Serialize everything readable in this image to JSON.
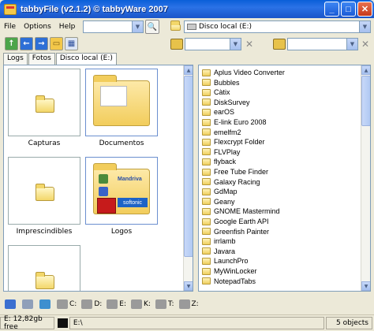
{
  "window": {
    "title": "tabbyFile (v2.1.2) © tabbyWare 2007",
    "min": "_",
    "max": "□",
    "close": "✕"
  },
  "menu": {
    "items": [
      "File",
      "Options",
      "Help"
    ]
  },
  "search": {
    "value": ""
  },
  "path_combo": {
    "value": "Disco local (E:)"
  },
  "toolbar": {
    "combo1": "",
    "combo2": ""
  },
  "tabs": [
    "Logs",
    "Fotos",
    "Disco local (E:)"
  ],
  "thumbnails": [
    {
      "label": "Capturas"
    },
    {
      "label": "Documentos"
    },
    {
      "label": "Imprescindibles"
    },
    {
      "label": "Logos"
    },
    {
      "label": ""
    }
  ],
  "logos_folder": {
    "brand1": "Mandriva",
    "brand2": "softonic"
  },
  "files": [
    "Aplus Video Converter",
    "Bubbles",
    "Càtix",
    "DiskSurvey",
    "earOS",
    "E-link Euro 2008",
    "emelfm2",
    "Flexcrypt Folder",
    "FLVPlay",
    "flyback",
    "Free Tube Finder",
    "Galaxy Racing",
    "GdMap",
    "Geany",
    "GNOME Mastermind",
    "Google Earth API",
    "Greenfish Painter",
    "irrlamb",
    "Javara",
    "LaunchPro",
    "MyWinLocker",
    "NotepadTabs"
  ],
  "drives": [
    "C:",
    "D:",
    "E:",
    "K:",
    "T:",
    "Z:"
  ],
  "status": {
    "free": "E: 12,82gb free",
    "cmd": "E:\\",
    "count": "5 objects"
  },
  "colors": {
    "titlebar": "#0a5fd8",
    "face": "#ece9d8",
    "folder": "#f2cd5c"
  }
}
